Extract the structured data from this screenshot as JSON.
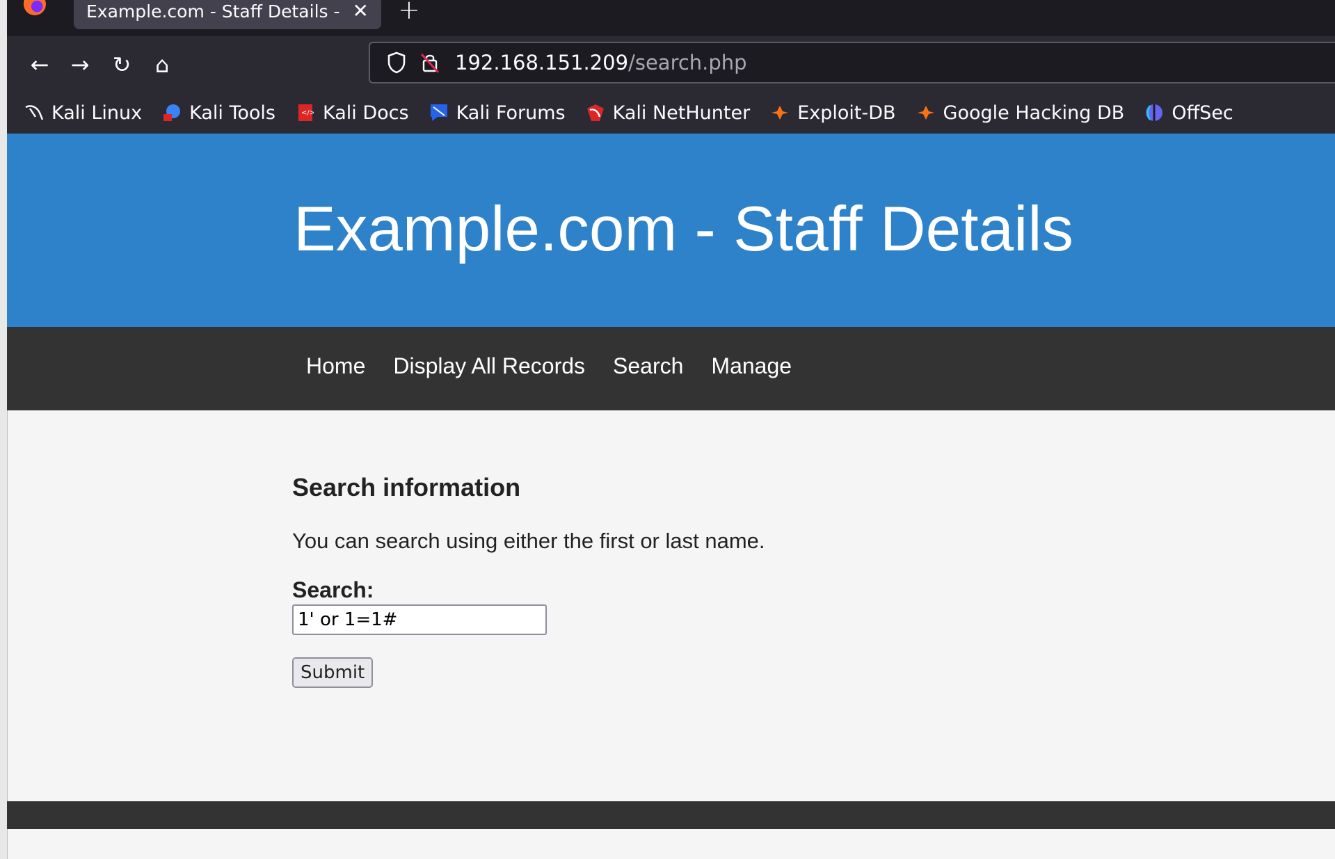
{
  "browser": {
    "tab_title": "Example.com - Staff Details - ",
    "tab_close": "✕",
    "new_tab": "+",
    "url_host": "192.168.151.209",
    "url_path": "/search.php",
    "nav": {
      "back": "←",
      "forward": "→",
      "reload": "↻",
      "home": "⌂"
    },
    "bookmarks": [
      {
        "label": "Kali Linux",
        "icon": "kali-dragon-icon",
        "color": "#ffffff"
      },
      {
        "label": "Kali Tools",
        "icon": "kali-tools-icon",
        "color": "#3b82f6"
      },
      {
        "label": "Kali Docs",
        "icon": "kali-docs-icon",
        "color": "#dc2626"
      },
      {
        "label": "Kali Forums",
        "icon": "kali-forums-icon",
        "color": "#2563eb"
      },
      {
        "label": "Kali NetHunter",
        "icon": "kali-nethunter-icon",
        "color": "#dc2626"
      },
      {
        "label": "Exploit-DB",
        "icon": "exploit-db-icon",
        "color": "#f97316"
      },
      {
        "label": "Google Hacking DB",
        "icon": "ghdb-icon",
        "color": "#f97316"
      },
      {
        "label": "OffSec",
        "icon": "offsec-icon",
        "color": "#6366f1"
      }
    ]
  },
  "site": {
    "title": "Example.com - Staff Details",
    "nav": [
      "Home",
      "Display All Records",
      "Search",
      "Manage"
    ]
  },
  "search": {
    "heading": "Search information",
    "description": "You can search using either the first or last name.",
    "label": "Search:",
    "value": "1' or 1=1#",
    "submit": "Submit"
  },
  "colors": {
    "header_bg": "#2e82c9",
    "nav_bg": "#333333",
    "page_bg": "#f5f5f5"
  }
}
